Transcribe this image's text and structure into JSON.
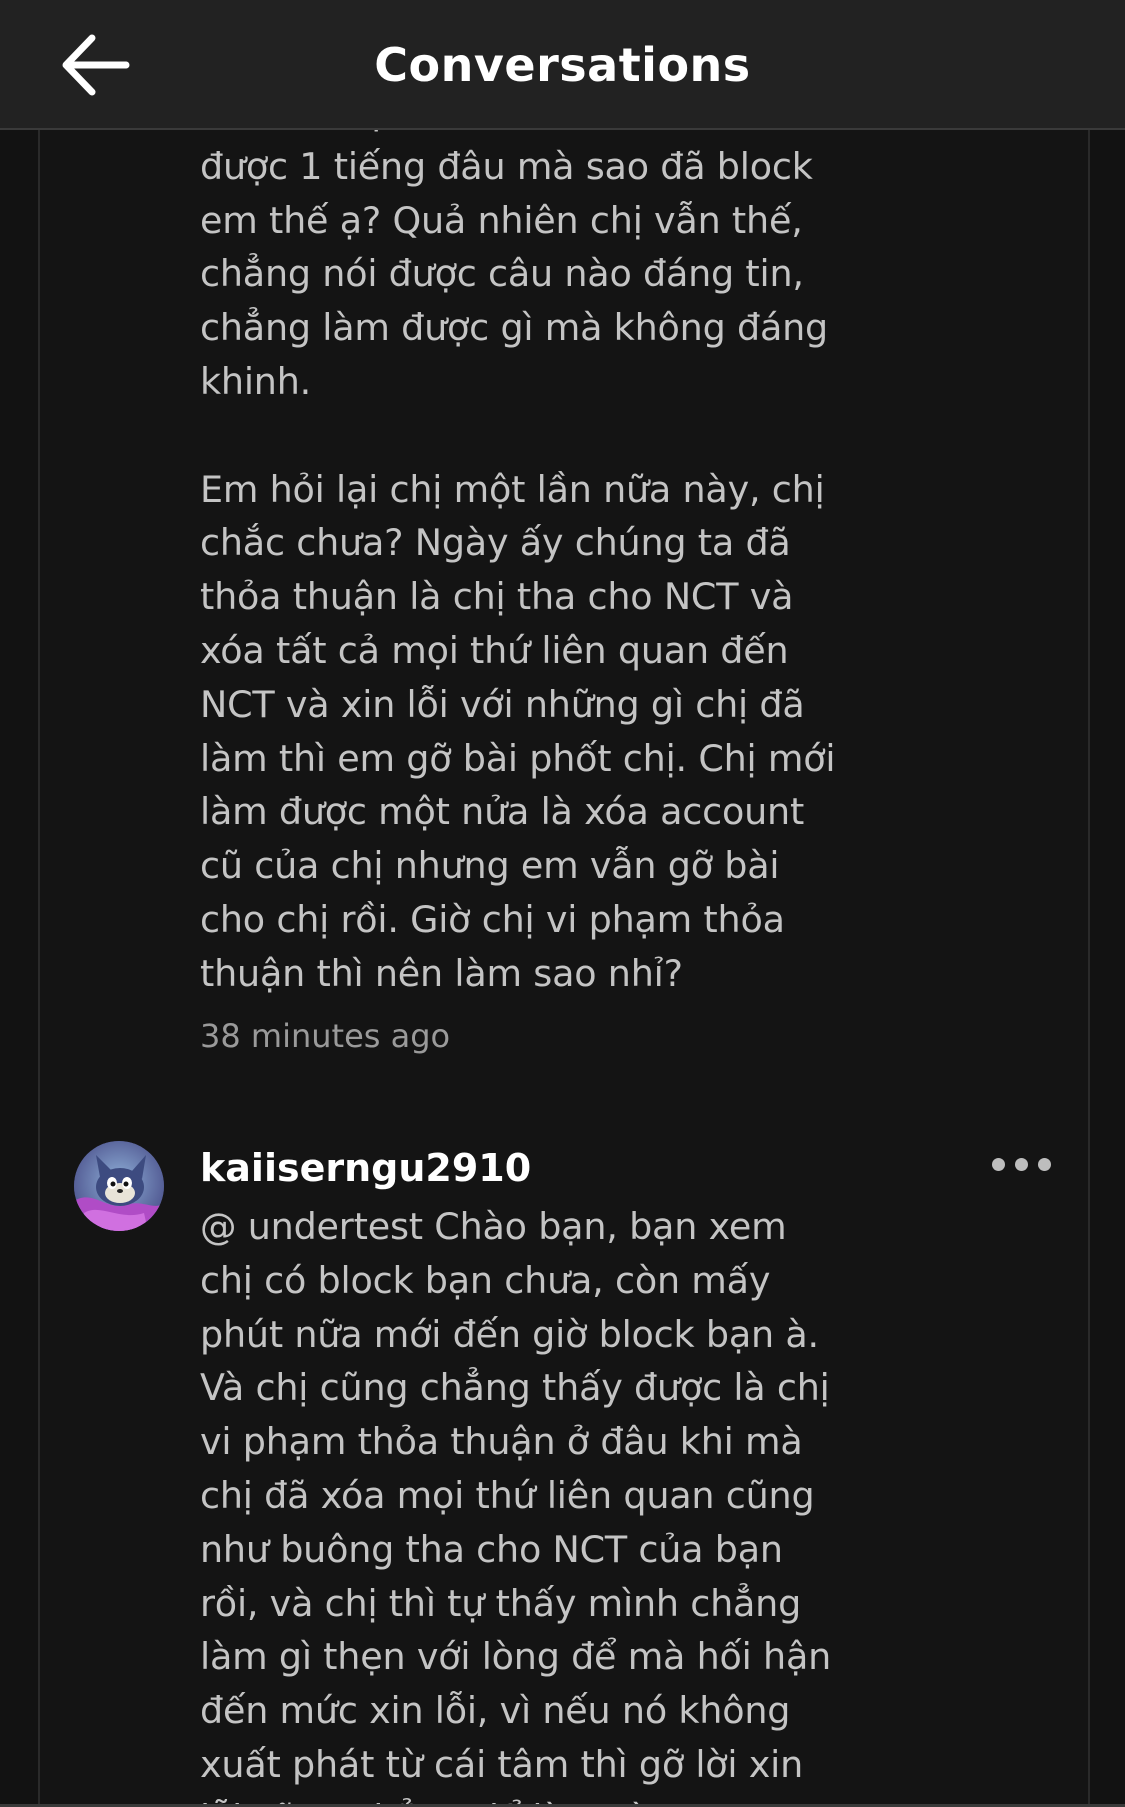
{
  "header": {
    "title": "Conversations",
    "back_icon": "arrow-left-icon"
  },
  "messages": [
    {
      "text": "ới bình luận trên bài… \nđược 1 tiếng đâu mà sao đã block\nem thế ạ? Quả nhiên chị vẫn thế,\nchẳng nói được câu nào đáng tin,\nchẳng làm được gì mà không đáng\nkhinh.\n\nEm hỏi lại chị một lần nữa này, chị\nchắc chưa? Ngày ấy chúng ta đã\nthỏa thuận là chị tha cho NCT và\nxóa tất cả mọi thứ liên quan đến\nNCT và xin lỗi với những gì chị đã\nlàm thì em gỡ bài phốt chị. Chị mới\nlàm được một nửa là xóa account\ncũ của chị nhưng em vẫn gỡ bài\ncho chị rồi. Giờ chị vi phạm thỏa\nthuận thì nên làm sao nhỉ?",
      "timestamp": "38 minutes ago"
    },
    {
      "username": "kaiiserngu2910",
      "avatar_icon": "cartoon-cat-avatar",
      "more_icon": "more-options-icon",
      "text": "@ undertest Chào bạn, bạn xem\nchị có block bạn chưa, còn mấy\nphút nữa mới đến giờ block bạn à.\nVà chị cũng chẳng thấy được là chị\nvi phạm thỏa thuận ở đâu khi mà\nchị đã xóa mọi thứ liên quan cũng\nnhư buông tha cho NCT của bạn\nrồi, và chị thì tự thấy mình chẳng\nlàm gì thẹn với lòng để mà hối hận\nđến mức xin lỗi, vì nếu nó không\nxuất phát từ cái tâm thì gỡ lời xin\nlỗi cũng chẳng để làm gì"
    }
  ],
  "colors": {
    "header_bg": "#222222",
    "body_bg": "#121212",
    "text": "#c4c4c4",
    "username": "#ffffff"
  }
}
